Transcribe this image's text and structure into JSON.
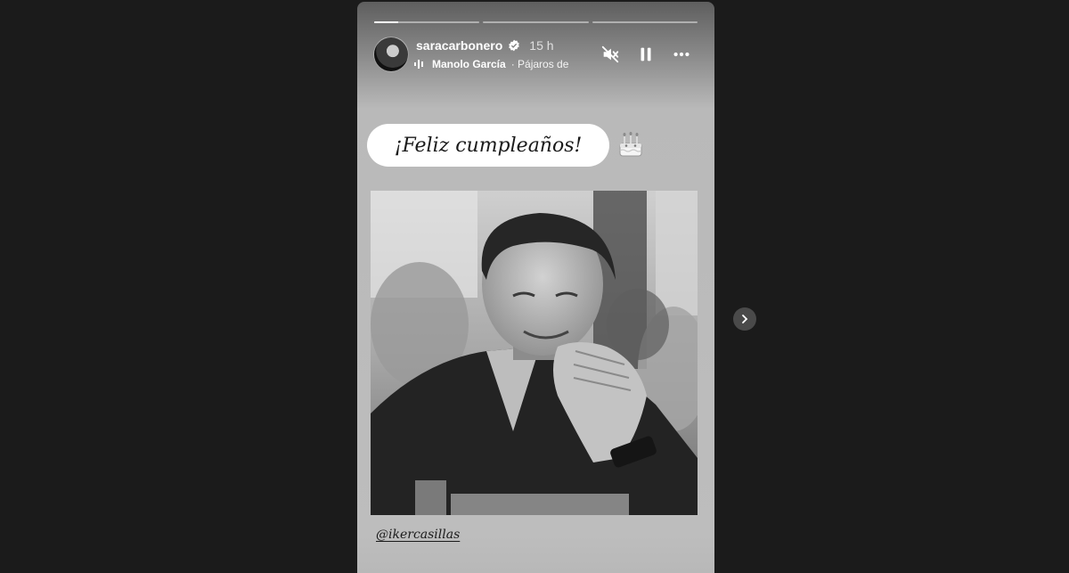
{
  "story": {
    "progress": [
      0.23,
      0,
      0
    ],
    "user": {
      "username": "saracarbonero",
      "time": "15 h",
      "verified": true
    },
    "music": {
      "artist": "Manolo García",
      "track": "· Pájaros de"
    },
    "controls": [
      "mute-icon",
      "pause-icon",
      "more-icon"
    ],
    "text": "¡Feliz cumpleaños!",
    "sticker": "birthday-cake-emoji",
    "mention": "@ikercasillas"
  },
  "colors": {
    "background": "#1b1b1b",
    "story_gray": "#bdbdbd",
    "progress_active": "#ffffff"
  }
}
